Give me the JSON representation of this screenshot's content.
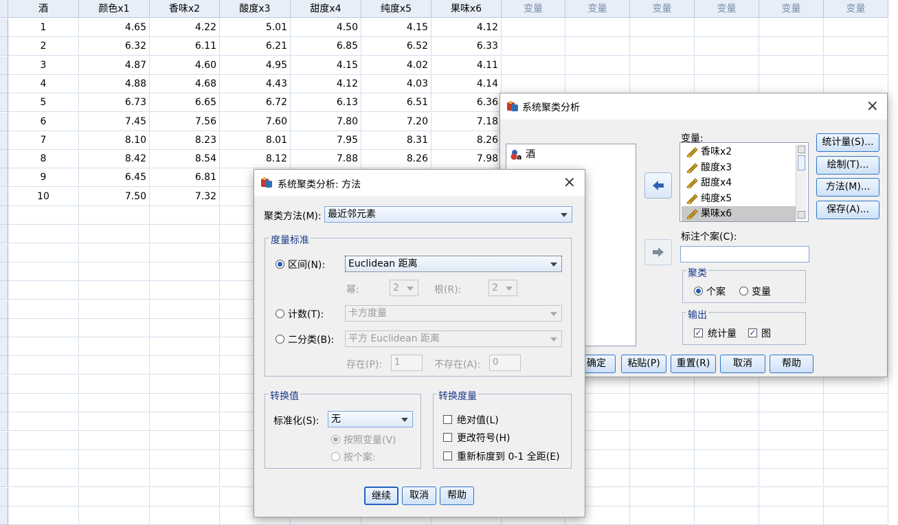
{
  "grid": {
    "headers": [
      "酒",
      "颜色x1",
      "香味x2",
      "酸度x3",
      "甜度x4",
      "纯度x5",
      "果味x6",
      "变量",
      "变量",
      "变量",
      "变量",
      "变量",
      "变量"
    ],
    "rows": [
      [
        "1",
        "4.65",
        "4.22",
        "5.01",
        "4.50",
        "4.15",
        "4.12"
      ],
      [
        "2",
        "6.32",
        "6.11",
        "6.21",
        "6.85",
        "6.52",
        "6.33"
      ],
      [
        "3",
        "4.87",
        "4.60",
        "4.95",
        "4.15",
        "4.02",
        "4.11"
      ],
      [
        "4",
        "4.88",
        "4.68",
        "4.43",
        "4.12",
        "4.03",
        "4.14"
      ],
      [
        "5",
        "6.73",
        "6.65",
        "6.72",
        "6.13",
        "6.51",
        "6.36"
      ],
      [
        "6",
        "7.45",
        "7.56",
        "7.60",
        "7.80",
        "7.20",
        "7.18"
      ],
      [
        "7",
        "8.10",
        "8.23",
        "8.01",
        "7.95",
        "8.31",
        "8.26"
      ],
      [
        "8",
        "8.42",
        "8.54",
        "8.12",
        "7.88",
        "8.26",
        "7.98"
      ],
      [
        "9",
        "6.45",
        "6.81",
        "",
        "",
        "",
        ""
      ],
      [
        "10",
        "7.50",
        "7.32",
        "",
        "",
        "",
        ""
      ]
    ]
  },
  "main_dialog": {
    "title": "系统聚类分析",
    "source_items": [
      "酒"
    ],
    "variables_label": "变量:",
    "variables": [
      "香味x2",
      "酸度x3",
      "甜度x4",
      "纯度x5",
      "果味x6"
    ],
    "label_cases_label": "标注个案(C):",
    "label_cases_value": "",
    "cluster_group": "聚类",
    "cluster_cases": "个案",
    "cluster_vars": "变量",
    "output_group": "输出",
    "output_stats": "统计量",
    "output_plots": "图",
    "side_buttons": [
      "统计量(S)...",
      "绘制(T)...",
      "方法(M)...",
      "保存(A)..."
    ],
    "bottom_buttons": [
      "确定",
      "粘贴(P)",
      "重置(R)",
      "取消",
      "帮助"
    ]
  },
  "method_dialog": {
    "title": "系统聚类分析: 方法",
    "cluster_method_label": "聚类方法(M):",
    "cluster_method_value": "最近邻元素",
    "measure_group": "度量标准",
    "interval_label": "区间(N):",
    "interval_value": "Euclidean 距离",
    "power_label": "幂:",
    "power_value": "2",
    "root_label": "根(R):",
    "root_value": "2",
    "counts_label": "计数(T):",
    "counts_value": "卡方度量",
    "binary_label": "二分类(B):",
    "binary_value": "平方 Euclidean 距离",
    "present_label": "存在(P):",
    "present_value": "1",
    "absent_label": "不存在(A):",
    "absent_value": "0",
    "transform_values_group": "转换值",
    "standardize_label": "标准化(S):",
    "standardize_value": "无",
    "by_variable": "按照变量(V)",
    "by_case": "按个案:",
    "transform_measures_group": "转换度量",
    "abs_values": "绝对值(L)",
    "change_sign": "更改符号(H)",
    "rescale": "重新标度到 0-1 全距(E)",
    "buttons": [
      "继续",
      "取消",
      "帮助"
    ]
  }
}
